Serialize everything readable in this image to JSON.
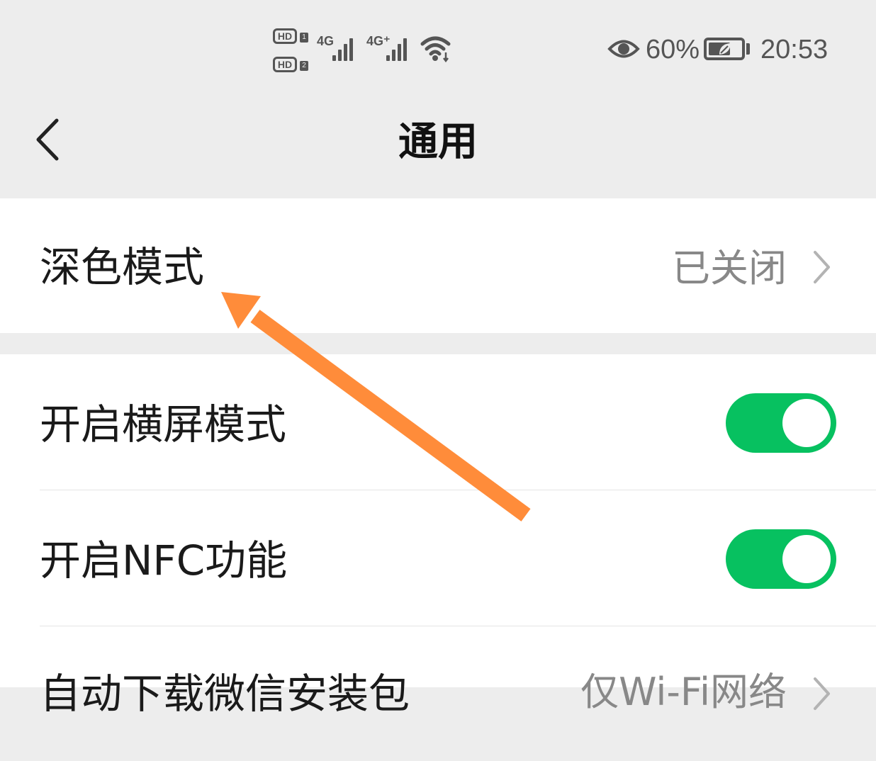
{
  "status_bar": {
    "sim1_badge": "HD",
    "sim1_index": "1",
    "sim2_badge": "HD",
    "sim2_index": "2",
    "net1": "4G",
    "net2": "4G⁺",
    "battery_percent_text": "60%",
    "battery_level": 0.6,
    "time": "20:53",
    "icons": [
      "eye-comfort-icon",
      "wifi-icon",
      "battery-saver-icon"
    ]
  },
  "nav": {
    "title": "通用",
    "back_icon": "chevron-left-icon"
  },
  "settings": {
    "dark_mode": {
      "label": "深色模式",
      "value": "已关闭"
    },
    "landscape": {
      "label": "开启横屏模式",
      "enabled": true
    },
    "nfc": {
      "label": "开启NFC功能",
      "enabled": true
    },
    "auto_download": {
      "label": "自动下载微信安装包",
      "value": "仅Wi-Fi网络"
    }
  },
  "colors": {
    "background": "#ededed",
    "toggle_on": "#07c160",
    "annotation_arrow": "#ff8c3a"
  }
}
